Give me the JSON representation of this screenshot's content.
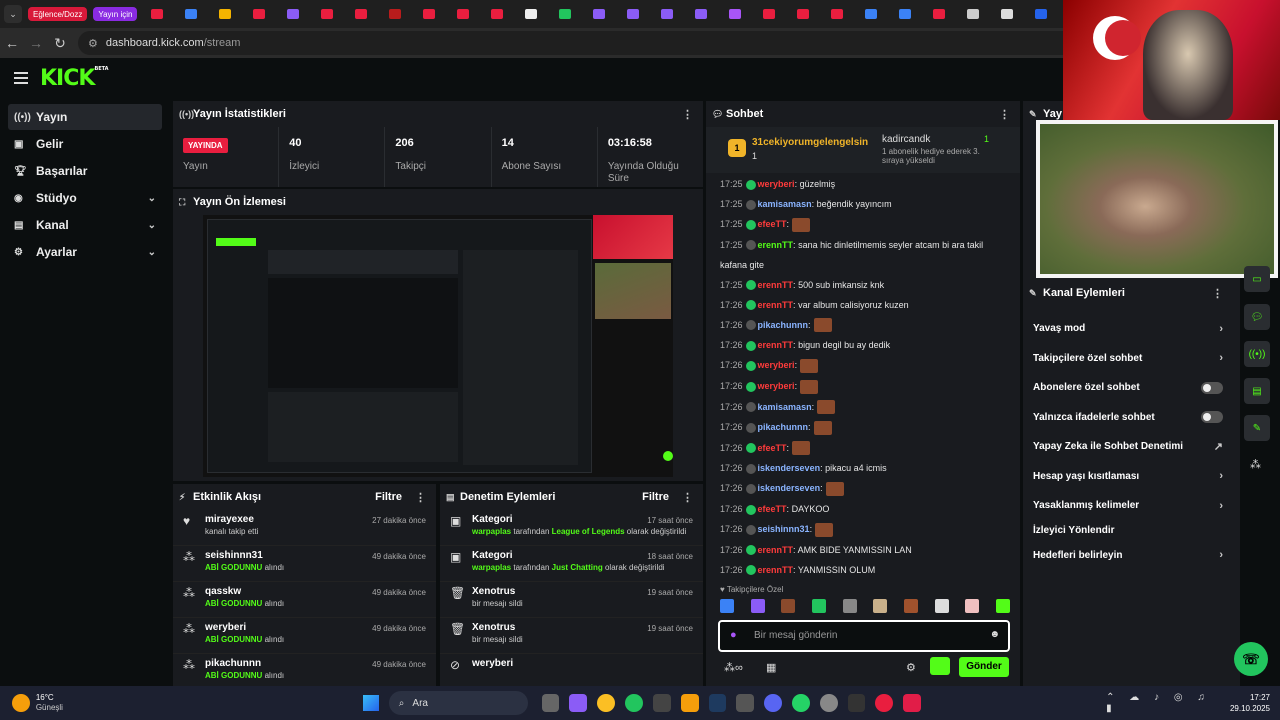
{
  "browser": {
    "bookmarks": [
      "Eğlence/Dozz",
      "Yayın için"
    ],
    "url_host": "dashboard.kick.com",
    "url_path": "/stream"
  },
  "app": {
    "logo": "KICK",
    "logo_tag": "BETA"
  },
  "sidebar": {
    "items": [
      {
        "label": "Yayın",
        "icon": "broadcast-icon"
      },
      {
        "label": "Gelir",
        "icon": "money-icon"
      },
      {
        "label": "Başarılar",
        "icon": "trophy-icon"
      },
      {
        "label": "Stüdyo",
        "icon": "studio-icon"
      },
      {
        "label": "Kanal",
        "icon": "channel-icon"
      },
      {
        "label": "Ayarlar",
        "icon": "gear-icon"
      }
    ]
  },
  "stats": {
    "title": "Yayın İstatistikleri",
    "live_badge": "YAYINDA",
    "live_label": "Yayın",
    "viewers_value": "40",
    "viewers_label": "İzleyici",
    "followers_value": "206",
    "followers_label": "Takipçi",
    "subs_value": "14",
    "subs_label": "Abone Sayısı",
    "uptime_value": "03:16:58",
    "uptime_label": "Yayında Olduğu Süre"
  },
  "preview": {
    "title": "Yayın Ön İzlemesi"
  },
  "activity": {
    "title": "Etkinlik Akışı",
    "filter": "Filtre",
    "rows": [
      {
        "name": "mirayexee",
        "sub": "kanalı takip etti",
        "time": "27 dakika önce"
      },
      {
        "name": "seishinnn31",
        "sub": "ABİ GODUNNU",
        "sub2": "alındı",
        "time": "49 dakika önce"
      },
      {
        "name": "qasskw",
        "sub": "ABİ GODUNNU",
        "sub2": "alındı",
        "time": "49 dakika önce"
      },
      {
        "name": "weryberi",
        "sub": "ABİ GODUNNU",
        "sub2": "alındı",
        "time": "49 dakika önce"
      },
      {
        "name": "pikachunnn",
        "sub": "ABİ GODUNNU",
        "sub2": "alındı",
        "time": "49 dakika önce"
      }
    ]
  },
  "moderation": {
    "title": "Denetim Eylemleri",
    "filter": "Filtre",
    "rows": [
      {
        "name": "Kategori",
        "user": "warpaplas",
        "mid": "tarafından",
        "game": "League of Legends",
        "end": "olarak değiştirildi",
        "time": "17 saat önce"
      },
      {
        "name": "Kategori",
        "user": "warpaplas",
        "mid": "tarafından",
        "game": "Just Chatting",
        "end": "olarak değiştirildi",
        "time": "18 saat önce"
      },
      {
        "name": "Xenotrus",
        "sub": "bir mesajı sildi",
        "time": "19 saat önce"
      },
      {
        "name": "Xenotrus",
        "sub": "bir mesajı sildi",
        "time": "19 saat önce"
      },
      {
        "name": "weryberi",
        "sub": "",
        "time": ""
      }
    ]
  },
  "chat": {
    "title": "Sohbet",
    "pinned_user": "31cekiyorumgelengelsin",
    "pinned_count": "1",
    "gift_user": "kadircandk",
    "gift_count": "1",
    "gift_text": "1 abonelik hediye ederek 3. sıraya yükseldi",
    "messages": [
      {
        "time": "17:25",
        "user": "weryberi",
        "color": "#ff3b3b",
        "text": " güzelmiş",
        "emote": false
      },
      {
        "time": "17:25",
        "user": "kamisamasn",
        "color": "#8ab4ff",
        "text": " beğendik yayıncım",
        "emote": false
      },
      {
        "time": "17:25",
        "user": "efeeTT",
        "color": "#ff3b3b",
        "text": "",
        "emote": true
      },
      {
        "time": "17:25",
        "user": "erennTT",
        "color": "#53fc18",
        "text": " sana hic dinletilmemis seyler atcam bi ara takil",
        "emote": false
      },
      {
        "time": "",
        "user": "",
        "color": "#fff",
        "text": "kafana gite",
        "emote": false
      },
      {
        "time": "17:25",
        "user": "erennTT",
        "color": "#ff3b3b",
        "text": " 500 sub imkansiz knk",
        "emote": false
      },
      {
        "time": "17:26",
        "user": "erennTT",
        "color": "#ff3b3b",
        "text": " var album calisiyoruz kuzen",
        "emote": false
      },
      {
        "time": "17:26",
        "user": "pikachunnn",
        "color": "#8ab4ff",
        "text": "",
        "emote": true
      },
      {
        "time": "17:26",
        "user": "erennTT",
        "color": "#ff3b3b",
        "text": " bigun degil bu ay dedik",
        "emote": false
      },
      {
        "time": "17:26",
        "user": "weryberi",
        "color": "#ff3b3b",
        "text": "",
        "emote": true
      },
      {
        "time": "17:26",
        "user": "weryberi",
        "color": "#ff3b3b",
        "text": "",
        "emote": true
      },
      {
        "time": "17:26",
        "user": "kamisamasn",
        "color": "#8ab4ff",
        "text": "",
        "emote": true
      },
      {
        "time": "17:26",
        "user": "pikachunnn",
        "color": "#8ab4ff",
        "text": "",
        "emote": true
      },
      {
        "time": "17:26",
        "user": "efeeTT",
        "color": "#ff3b3b",
        "text": "",
        "emote": true
      },
      {
        "time": "17:26",
        "user": "iskenderseven",
        "color": "#8ab4ff",
        "text": " pikacu a4 icmis",
        "emote": false
      },
      {
        "time": "17:26",
        "user": "iskenderseven",
        "color": "#8ab4ff",
        "text": "",
        "emote": true
      },
      {
        "time": "17:26",
        "user": "efeeTT",
        "color": "#ff3b3b",
        "text": " DAYKOO",
        "emote": false
      },
      {
        "time": "17:26",
        "user": "seishinnn31",
        "color": "#8ab4ff",
        "text": "",
        "emote": true
      },
      {
        "time": "17:26",
        "user": "erennTT",
        "color": "#ff3b3b",
        "text": " AMK BIDE YANMISSIN LAN",
        "emote": false
      },
      {
        "time": "17:26",
        "user": "erennTT",
        "color": "#ff3b3b",
        "text": " YANMISSIN OLUM",
        "emote": false
      }
    ],
    "followers_only": "Takipçilere Özel",
    "input_placeholder": "Bir mesaj gönderin",
    "send_label": "Gönder"
  },
  "channel_actions": {
    "title": "Kanal Eylemleri",
    "rows": [
      {
        "label": "Yavaş mod",
        "kind": "chev"
      },
      {
        "label": "Takipçilere özel sohbet",
        "kind": "chev"
      },
      {
        "label": "Abonelere özel sohbet",
        "kind": "toggle"
      },
      {
        "label": "Yalnızca ifadelerle sohbet",
        "kind": "toggle"
      },
      {
        "label": "Yapay Zeka ile Sohbet Denetimi",
        "kind": "ext"
      },
      {
        "label": "Hesap yaşı kısıtlaması",
        "kind": "chev"
      },
      {
        "label": "Yasaklanmış kelimeler",
        "kind": "chev"
      },
      {
        "label": "İzleyici Yönlendir",
        "kind": "none"
      },
      {
        "label": "Hedefleri belirleyin",
        "kind": "chev"
      }
    ]
  },
  "taskbar": {
    "weather_temp": "16°C",
    "weather_city": "Güneşli",
    "search_label": "Ara",
    "time": "17:27",
    "date": "29.10.2025"
  },
  "colors": {
    "accent": "#53fc18",
    "live": "#e91e3f",
    "panel": "#191b1f",
    "bg": "#0b0e0f"
  }
}
